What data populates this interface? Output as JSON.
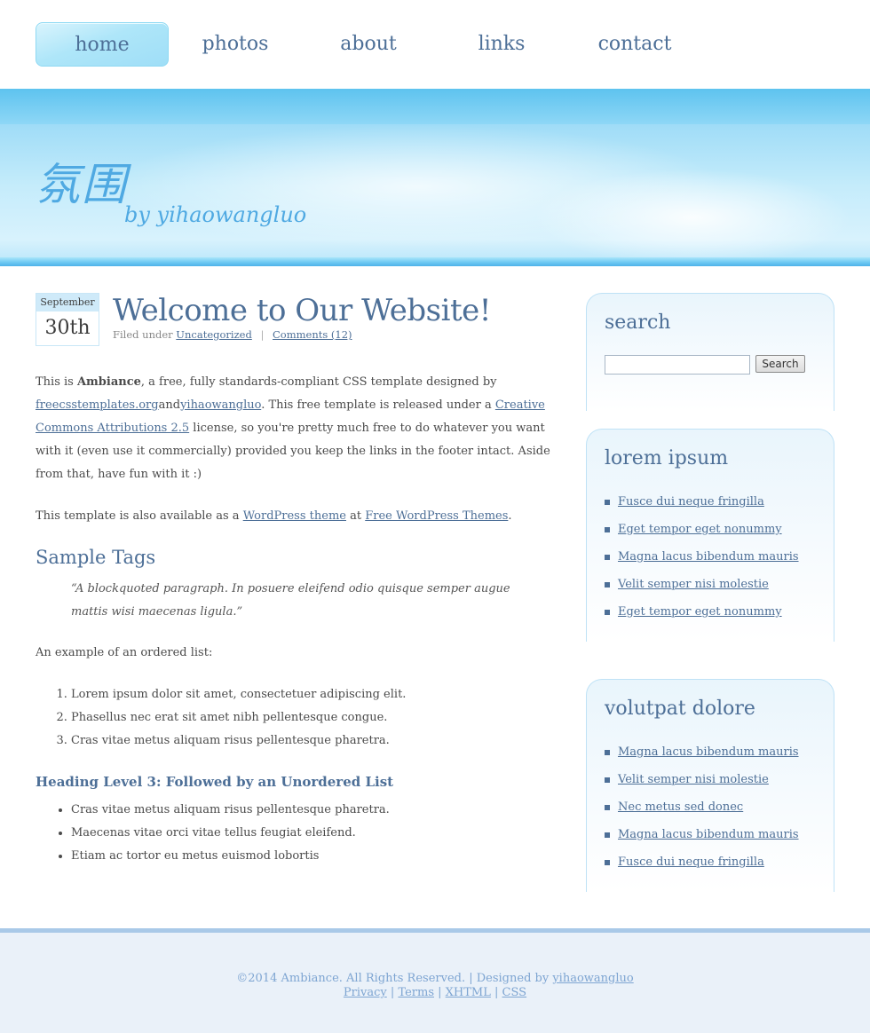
{
  "nav": {
    "items": [
      {
        "label": "home",
        "active": true
      },
      {
        "label": "photos",
        "active": false
      },
      {
        "label": "about",
        "active": false
      },
      {
        "label": "links",
        "active": false
      },
      {
        "label": "contact",
        "active": false
      }
    ]
  },
  "header": {
    "title": "氛围",
    "subtitle": "by yihaowangluo"
  },
  "post": {
    "date_month": "September",
    "date_day": "30th",
    "title": "Welcome to Our Website!",
    "filed_under_text": "Filed under",
    "category": "Uncategorized",
    "separator": "|",
    "comments": "Comments (12)",
    "p1_a": "This is ",
    "p1_bold": "Ambiance",
    "p1_b": ", a free, fully standards-compliant CSS template designed by ",
    "p1_link1": "freecsstemplates.org",
    "p1_and": "and",
    "p1_link2": "yihaowangluo",
    "p1_c": ". This free template is released under a ",
    "p1_link3": "Creative Commons Attributions 2.5",
    "p1_d": " license, so you're pretty much free to do whatever you want with it (even use it commercially) provided you keep the links in the footer intact. Aside from that, have fun with it :)",
    "p2_a": "This template is also available as a ",
    "p2_link1": "WordPress theme",
    "p2_b": " at ",
    "p2_link2": "Free WordPress Themes",
    "p2_c": ".",
    "h2": "Sample Tags",
    "blockquote": "“A blockquoted paragraph. In posuere eleifend odio quisque semper augue mattis wisi maecenas ligula.”",
    "ol_intro": "An example of an ordered list:",
    "ol_items": [
      "Lorem ipsum dolor sit amet, consectetuer adipiscing elit.",
      "Phasellus nec erat sit amet nibh pellentesque congue.",
      "Cras vitae metus aliquam risus pellentesque pharetra."
    ],
    "h3": "Heading Level 3: Followed by an Unordered List",
    "ul_items": [
      "Cras vitae metus aliquam risus pellentesque pharetra.",
      "Maecenas vitae orci vitae tellus feugiat eleifend.",
      "Etiam ac tortor eu metus euismod lobortis"
    ]
  },
  "sidebar": {
    "search": {
      "title": "search",
      "button": "Search",
      "value": ""
    },
    "lorem": {
      "title": "lorem ipsum",
      "items": [
        "Fusce dui neque fringilla",
        "Eget tempor eget nonummy",
        "Magna lacus bibendum mauris",
        "Velit semper nisi molestie",
        "Eget tempor eget nonummy"
      ]
    },
    "volutpat": {
      "title": "volutpat dolore",
      "items": [
        "Magna lacus bibendum mauris",
        "Velit semper nisi molestie",
        "Nec metus sed donec",
        "Magna lacus bibendum mauris",
        "Fusce dui neque fringilla"
      ]
    }
  },
  "footer": {
    "copyright": "©2014 Ambiance. All Rights Reserved. | Designed by ",
    "designer_link": "yihaowangluo",
    "links": [
      "Privacy",
      "Terms",
      "XHTML",
      "CSS"
    ],
    "sep": " | "
  }
}
